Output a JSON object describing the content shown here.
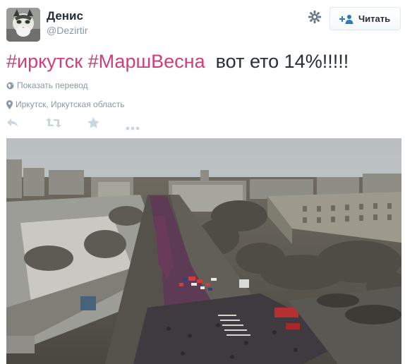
{
  "user": {
    "fullname": "Денис",
    "screenname": "@Dezirtir"
  },
  "follow_button": {
    "label": "Читать"
  },
  "tweet": {
    "hashtag_1": "#иркутск",
    "hashtag_2": "#МаршВесна",
    "text": "вот ето 14%!!!!!"
  },
  "translate_link": "Показать перевод",
  "location": "Иркутск, Иркутская область",
  "icons": {
    "settings": "gear-icon",
    "follow": "follow-person-plus-icon",
    "translate": "globe-icon",
    "location": "location-pin-icon",
    "reply": "reply-icon",
    "retweet": "retweet-icon",
    "favorite": "star-icon",
    "more": "more-dots-icon"
  },
  "colors": {
    "hashtag": "#ce3e7c",
    "secondary_text": "#8899a6",
    "action_icon": "#ccd6dd",
    "follow_icon": "#2b7bb9"
  },
  "photo": {
    "alt": ""
  }
}
